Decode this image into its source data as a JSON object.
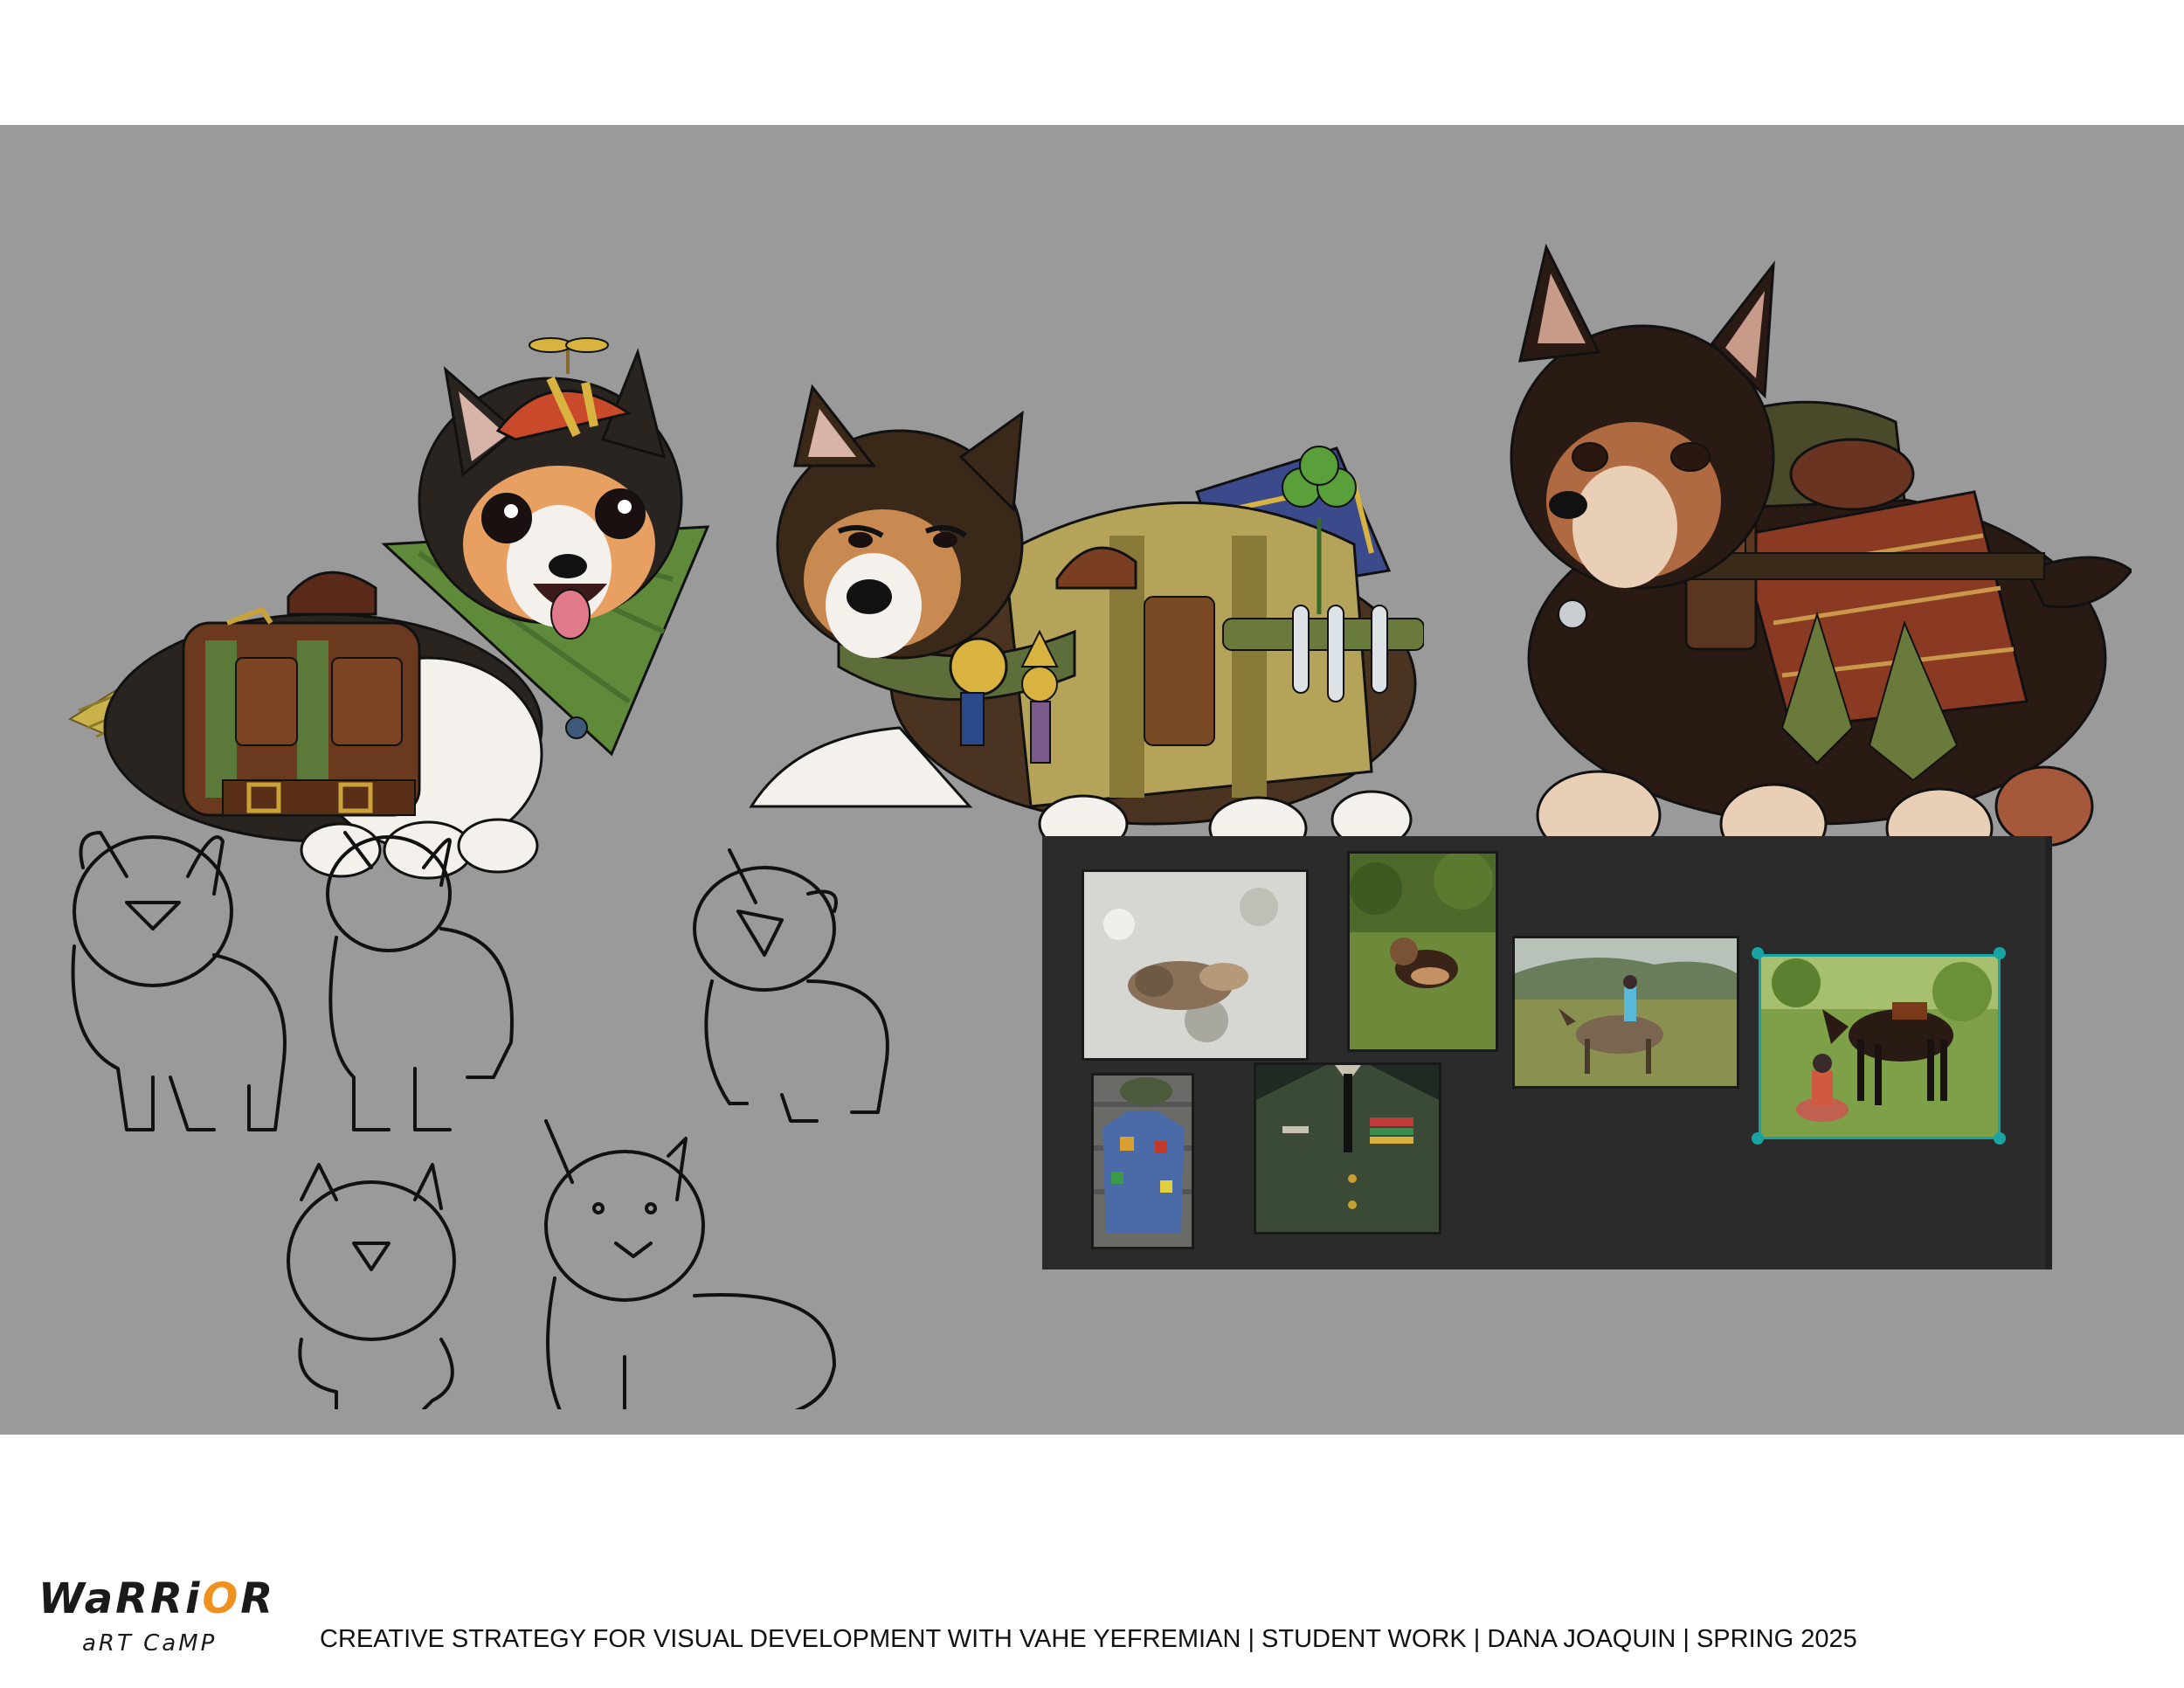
{
  "logo": {
    "line1_prefix": "WaRRi",
    "line1_o": "O",
    "line1_suffix": "R",
    "line2": "aRT CaMP",
    "accent_color": "#f0901e"
  },
  "footer": {
    "credits": "CREATIVE STRATEGY FOR VISUAL DEVELOPMENT WITH VAHE YEFREMIAN |  STUDENT WORK  |  DANA JOAQUIN  |  SPRING 2025"
  },
  "colors": {
    "panel": "#9a9a9a",
    "moodboard": "#2b2b2b",
    "selection": "#1aa3a3"
  }
}
